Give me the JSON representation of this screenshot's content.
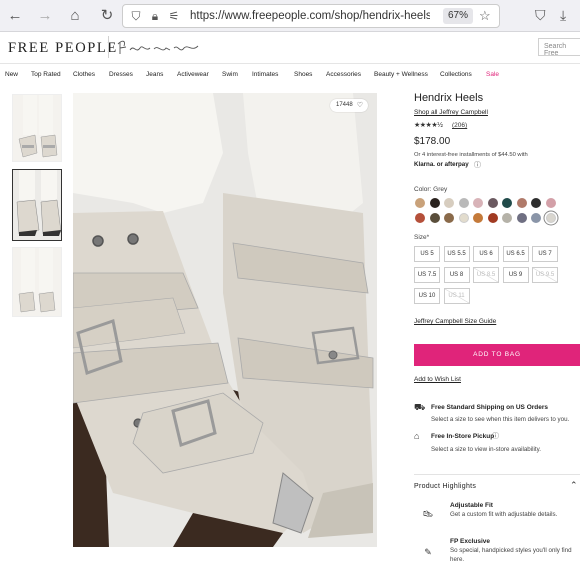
{
  "browser": {
    "url_main": "https://www.freepeople.com/shop/hendrix-heels/?ca",
    "zoom": "67%"
  },
  "header": {
    "brand": "FREE PEOPLE",
    "sub_brand": "fp movement",
    "search_placeholder": "Search Free"
  },
  "nav": {
    "items": [
      "New",
      "Top Rated",
      "Clothes",
      "Dresses",
      "Jeans",
      "Activewear",
      "Swim",
      "Intimates",
      "Shoes",
      "Accessories",
      "Beauty + Wellness",
      "Collections",
      "Sale"
    ]
  },
  "image": {
    "likes": "17448"
  },
  "product": {
    "title": "Hendrix Heels",
    "shop_link": "Shop all Jeffrey Campbell",
    "stars": "★★★★½",
    "rating": 4.5,
    "reviews": "(206)",
    "price": "$178.00",
    "installments": "Or 4 interest-free installments of $44.50 with",
    "klarna": "Klarna. or afterpay",
    "color_label": "Color: Grey",
    "swatches": [
      "#c9a27a",
      "#2a221e",
      "#d7cdbf",
      "#b9b9b9",
      "#d8b3b8",
      "#6b5960",
      "#214b4a",
      "#b07a6a",
      "#2e2e2e",
      "#d3a0a8",
      "#b5503a",
      "#5a4e3b",
      "#8a6a4a",
      "#e2dccd",
      "#c47a3a",
      "#a13a22",
      "#b5b2a8",
      "#6f6f82",
      "#8a95a8",
      "#d9d6cf"
    ],
    "selected_swatch": 19,
    "size_label": "Size*",
    "sizes": [
      {
        "label": "US 5",
        "available": true
      },
      {
        "label": "US 5.5",
        "available": true
      },
      {
        "label": "US 6",
        "available": true
      },
      {
        "label": "US 6.5",
        "available": true
      },
      {
        "label": "US 7",
        "available": true
      },
      {
        "label": "US 7.5",
        "available": true
      },
      {
        "label": "US 8",
        "available": true
      },
      {
        "label": "US 8.5",
        "available": false
      },
      {
        "label": "US 9",
        "available": true
      },
      {
        "label": "US 9.5",
        "available": false
      },
      {
        "label": "US 10",
        "available": true
      },
      {
        "label": "US 11",
        "available": false
      }
    ],
    "size_guide": "Jeffrey Campbell Size Guide",
    "add_to_bag": "ADD TO BAG",
    "wishlist": "Add to Wish List"
  },
  "shipping": [
    {
      "title": "Free Standard Shipping on US Orders",
      "sub": "Select a size to see when this item delivers to you."
    },
    {
      "title": "Free In-Store Pickup",
      "sub": "Select a size to view in-store availability."
    }
  ],
  "highlights": {
    "title": "Product Highlights",
    "items": [
      {
        "title": "Adjustable Fit",
        "sub": "Get a custom fit with adjustable details."
      },
      {
        "title": "FP Exclusive",
        "sub": "So special, handpicked styles you'll only find here."
      }
    ]
  }
}
